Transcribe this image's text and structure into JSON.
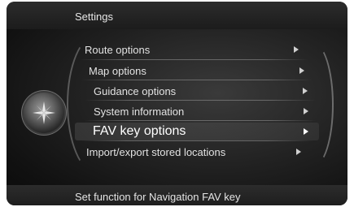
{
  "header": {
    "title": "Settings"
  },
  "menu": {
    "items": [
      {
        "label": "Route options",
        "selected": false
      },
      {
        "label": "Map options",
        "selected": false
      },
      {
        "label": "Guidance options",
        "selected": false
      },
      {
        "label": "System information",
        "selected": false
      },
      {
        "label": "FAV key options",
        "selected": true
      },
      {
        "label": "Import/export stored locations",
        "selected": false
      }
    ]
  },
  "footer": {
    "description": "Set function for Navigation FAV key"
  },
  "controller": {
    "icon": "navigation-rose-icon"
  }
}
